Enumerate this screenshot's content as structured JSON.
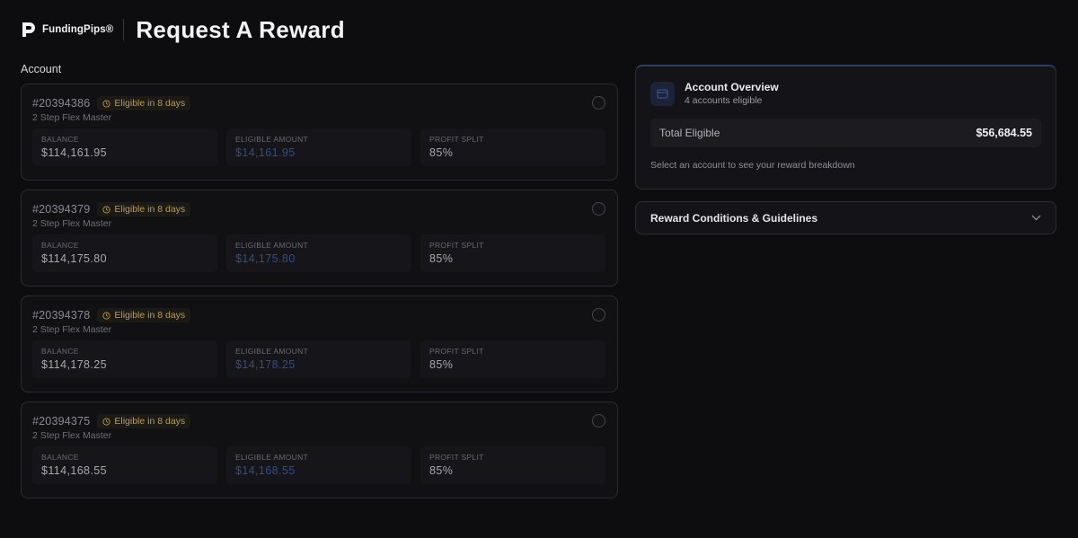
{
  "brand": {
    "name": "FundingPips®"
  },
  "page": {
    "title": "Request A Reward",
    "section_label": "Account"
  },
  "labels": {
    "balance": "BALANCE",
    "eligible_amount": "ELIGIBLE AMOUNT",
    "profit_split": "PROFIT SPLIT"
  },
  "accounts": [
    {
      "id": "#20394386",
      "badge": "Eligible in 8 days",
      "type": "2 Step Flex Master",
      "balance": "$114,161.95",
      "eligible": "$14,161.95",
      "split": "85%"
    },
    {
      "id": "#20394379",
      "badge": "Eligible in 8 days",
      "type": "2 Step Flex Master",
      "balance": "$114,175.80",
      "eligible": "$14,175.80",
      "split": "85%"
    },
    {
      "id": "#20394378",
      "badge": "Eligible in 8 days",
      "type": "2 Step Flex Master",
      "balance": "$114,178.25",
      "eligible": "$14,178.25",
      "split": "85%"
    },
    {
      "id": "#20394375",
      "badge": "Eligible in 8 days",
      "type": "2 Step Flex Master",
      "balance": "$114,168.55",
      "eligible": "$14,168.55",
      "split": "85%"
    }
  ],
  "overview": {
    "title": "Account Overview",
    "subtitle": "4 accounts eligible",
    "total_label": "Total Eligible",
    "total_value": "$56,684.55",
    "hint": "Select an account to see your reward breakdown"
  },
  "guidelines": {
    "label": "Reward Conditions & Guidelines"
  },
  "icons": {
    "logo": "fundingpips-logo-icon",
    "badge": "clock-icon",
    "overview": "wallet-icon",
    "expand": "chevron-down-icon"
  },
  "colors": {
    "accent_blue": "#2e4f86",
    "badge_gold": "#b99a5a",
    "background": "#0d0d0f"
  }
}
